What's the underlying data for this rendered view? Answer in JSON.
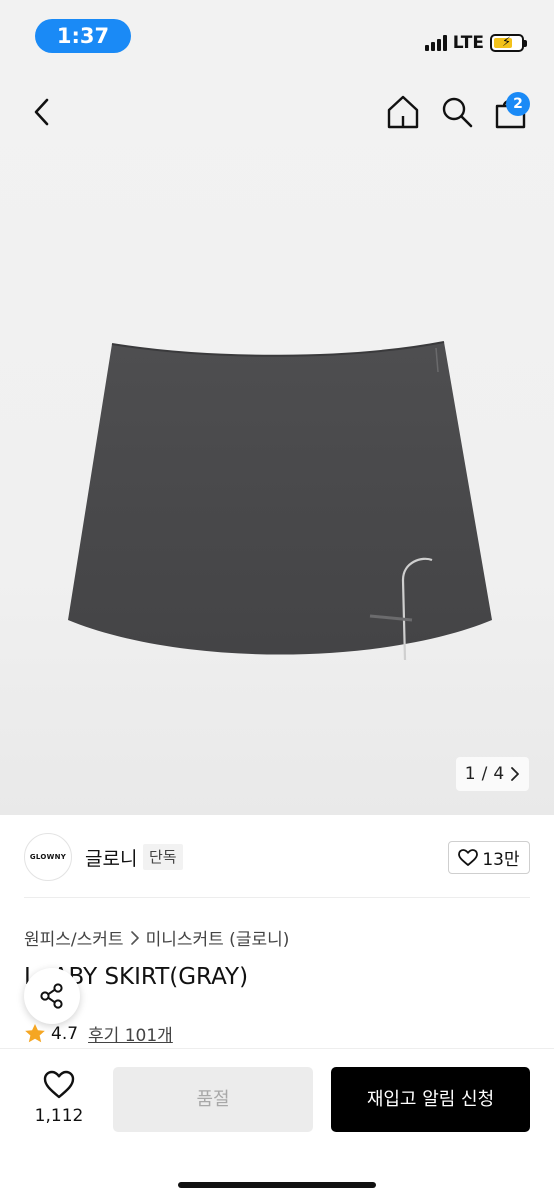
{
  "status_bar": {
    "time": "1:37",
    "network": "LTE"
  },
  "nav": {
    "cart_count": "2"
  },
  "gallery": {
    "current": "1",
    "total": "4",
    "separator": "/"
  },
  "brand": {
    "logo_text": "GLOWNY",
    "name": "글로니",
    "tag": "단독",
    "likes": "13만"
  },
  "breadcrumb": {
    "category": "원피스/스커트",
    "subcategory": "미니스커트 (글로니)"
  },
  "product": {
    "title": "ABY SKIRT(GRAY)",
    "title_prefix": "L",
    "rating": "4.7",
    "reviews": "후기 101개"
  },
  "bottom_bar": {
    "wish_count": "1,112",
    "soldout_label": "품절",
    "restock_label": "재입고 알림 신청"
  },
  "colors": {
    "accent": "#1a8af6",
    "star": "#f5a623",
    "skirt": "#4b4b4d"
  }
}
